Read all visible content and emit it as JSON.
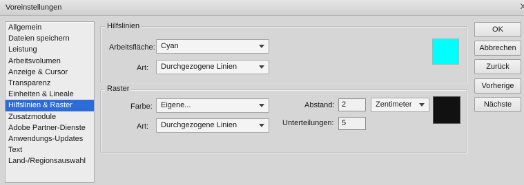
{
  "window": {
    "title": "Voreinstellungen",
    "close_glyph": "X"
  },
  "sidebar": {
    "items": [
      {
        "label": "Allgemein"
      },
      {
        "label": "Dateien speichern"
      },
      {
        "label": "Leistung"
      },
      {
        "label": "Arbeitsvolumen"
      },
      {
        "label": "Anzeige & Cursor"
      },
      {
        "label": "Transparenz"
      },
      {
        "label": "Einheiten & Lineale"
      },
      {
        "label": "Hilfslinien & Raster",
        "selected": true
      },
      {
        "label": "Zusatzmodule"
      },
      {
        "label": "Adobe Partner-Dienste"
      },
      {
        "label": "Anwendungs-Updates"
      },
      {
        "label": "Text"
      },
      {
        "label": "Land-/Regionsauswahl"
      }
    ]
  },
  "guides": {
    "legend": "Hilfslinien",
    "workspace_label": "Arbeitsfläche:",
    "workspace_value": "Cyan",
    "style_label": "Art:",
    "style_value": "Durchgezogene Linien",
    "color": "#00ffff"
  },
  "grid": {
    "legend": "Raster",
    "color_label": "Farbe:",
    "color_value": "Eigene...",
    "style_label": "Art:",
    "style_value": "Durchgezogene Linien",
    "spacing_label": "Abstand:",
    "spacing_value": "2",
    "units_value": "Zentimeter",
    "subdivisions_label": "Unterteilungen:",
    "subdivisions_value": "5",
    "color": "#111111"
  },
  "buttons": {
    "ok": "OK",
    "cancel": "Abbrechen",
    "back": "Zurück",
    "previous": "Vorherige",
    "next": "Nächste"
  }
}
